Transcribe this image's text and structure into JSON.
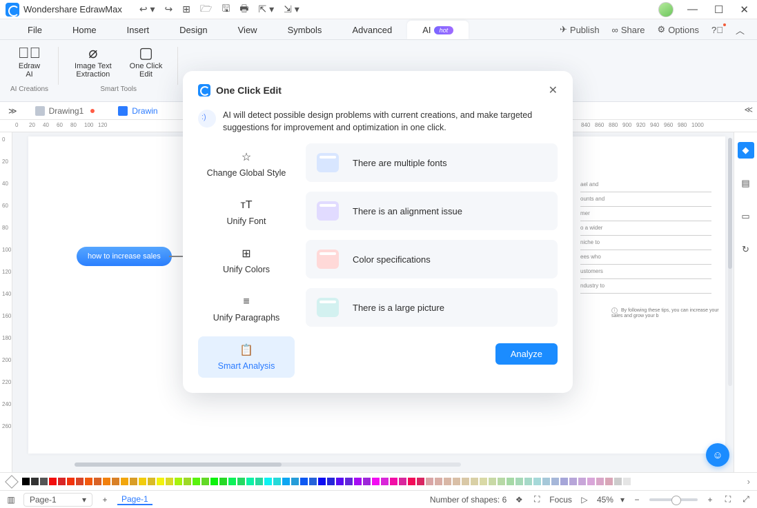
{
  "app_title": "Wondershare EdrawMax",
  "menubar": [
    "File",
    "Home",
    "Insert",
    "Design",
    "View",
    "Symbols",
    "Advanced"
  ],
  "menubar_ai": "AI",
  "menubar_badge": "hot",
  "menubar_right": {
    "publish": "Publish",
    "share": "Share",
    "options": "Options"
  },
  "ribbon": {
    "ai_creations": {
      "edraw_ai": "Edraw\nAI",
      "caption": "AI Creations"
    },
    "smart": {
      "img_text": "Image Text\nExtraction",
      "one_click": "One Click\nEdit",
      "caption": "Smart Tools"
    }
  },
  "doctabs": {
    "drawing1": "Drawing1",
    "drawing2": "Drawin"
  },
  "canvas": {
    "node": "how to increase sales",
    "small_lines": [
      "ael and",
      "ounts and",
      "mer",
      "o a wider",
      "niche to",
      "ees who",
      "ustomers",
      "ndustry to"
    ],
    "tip_line": "By following these tips, you can increase your sales and grow your b"
  },
  "ruler_h": [
    0,
    20,
    40,
    60,
    80,
    100,
    120,
    840,
    860,
    880,
    900,
    920,
    940,
    960,
    980,
    1000
  ],
  "ruler_v": [
    0,
    20,
    40,
    60,
    80,
    100,
    120,
    140,
    160,
    180,
    200,
    220,
    240,
    260
  ],
  "modal": {
    "title": "One Click Edit",
    "desc": "AI will detect possible design problems with current creations, and make targeted suggestions for improvement and optimization in one click.",
    "options": [
      "Change Global Style",
      "Unify Font",
      "Unify Colors",
      "Unify Paragraphs",
      "Smart Analysis"
    ],
    "cards": [
      "There are multiple fonts",
      "There is an alignment issue",
      "Color specifications",
      "There is a large picture"
    ],
    "analyze": "Analyze"
  },
  "status": {
    "page_select": "Page-1",
    "page_tab": "Page-1",
    "shapes": "Number of shapes: 6",
    "focus": "Focus",
    "zoom": "45%"
  }
}
